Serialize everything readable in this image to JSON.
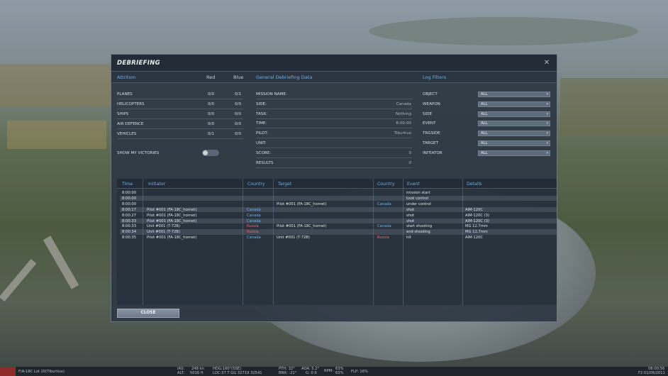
{
  "dialog": {
    "title": "DEBRIEFING",
    "close_icon": "close-icon"
  },
  "sections": {
    "attrition": "Attrition",
    "red": "Red",
    "blue": "Blue",
    "general": "General Debriefing Data",
    "filters": "Log Filters"
  },
  "attrition": [
    {
      "label": "PLANES",
      "red": "0/0",
      "blue": "0/1"
    },
    {
      "label": "HELICOPTERS",
      "red": "0/0",
      "blue": "0/0"
    },
    {
      "label": "SHIPS",
      "red": "0/0",
      "blue": "0/0"
    },
    {
      "label": "AIR DEFENCE",
      "red": "0/0",
      "blue": "0/0"
    },
    {
      "label": "VEHICLES",
      "red": "0/1",
      "blue": "0/0"
    }
  ],
  "show_victories": "SHOW MY VICTORIES",
  "general": [
    {
      "label": "MISSION NAME:",
      "value": ""
    },
    {
      "label": "SIDE:",
      "value": "Canada"
    },
    {
      "label": "TASK:",
      "value": "Nothing"
    },
    {
      "label": "TIME:",
      "value": "8:00:00"
    },
    {
      "label": "PILOT:",
      "value": "Tiburtius"
    },
    {
      "label": "UNIT:",
      "value": ""
    },
    {
      "label": "SCORE:",
      "value": "0"
    },
    {
      "label": "RESULTS",
      "value": "0"
    }
  ],
  "filters": [
    {
      "label": "OBJECT",
      "value": "ALL"
    },
    {
      "label": "WEAPON",
      "value": "ALL"
    },
    {
      "label": "SIDE",
      "value": "ALL"
    },
    {
      "label": "EVENT",
      "value": "ALL"
    },
    {
      "label": "TRGSIDE",
      "value": "ALL"
    },
    {
      "label": "TARGET",
      "value": "ALL"
    },
    {
      "label": "INITIATOR",
      "value": "ALL"
    }
  ],
  "log": {
    "columns": {
      "time": "Time",
      "initiator": "Initiator",
      "country": "Country",
      "target": "Target",
      "tcountry": "Country",
      "event": "Event",
      "details": "Details"
    },
    "rows": [
      {
        "time": "8:00:00",
        "initiator": "",
        "country": "",
        "target": "",
        "tcountry": "",
        "event": "mission start",
        "details": ""
      },
      {
        "time": "8:00:00",
        "initiator": "",
        "country": "",
        "target": "",
        "tcountry": "",
        "event": "took control",
        "details": ""
      },
      {
        "time": "8:00:00",
        "initiator": "",
        "country": "",
        "target": "Pilot #001 (FA-18C_hornet)",
        "tcountry": "Canada",
        "event": "under control",
        "details": ""
      },
      {
        "time": "8:00:17",
        "initiator": "Pilot #001 (FA-18C_hornet)",
        "country": "Canada",
        "target": "",
        "tcountry": "",
        "event": "shot",
        "details": "AIM-120C"
      },
      {
        "time": "8:00:27",
        "initiator": "Pilot #001 (FA-18C_hornet)",
        "country": "Canada",
        "target": "",
        "tcountry": "",
        "event": "shot",
        "details": "AIM-120C (3)"
      },
      {
        "time": "8:00:33",
        "initiator": "Pilot #001 (FA-18C_hornet)",
        "country": "Canada",
        "target": "",
        "tcountry": "",
        "event": "shot",
        "details": "AIM-120C (3)"
      },
      {
        "time": "8:00:33",
        "initiator": "Unit #001 (T-72B)",
        "country": "Russia",
        "target": "Pilot #001 (FA-18C_hornet)",
        "tcountry": "Canada",
        "event": "start shooting",
        "details": "MG 12.7mm"
      },
      {
        "time": "8:00:34",
        "initiator": "Unit #001 (T-72B)",
        "country": "Russia",
        "target": "",
        "tcountry": "",
        "event": "end shooting",
        "details": "MG 12.7mm"
      },
      {
        "time": "8:00:35",
        "initiator": "Pilot #001 (FA-18C_hornet)",
        "country": "Canada",
        "target": "Unit #001 (T-72B)",
        "tcountry": "Russia",
        "event": "hit",
        "details": "AIM-120C"
      }
    ]
  },
  "close_label": "CLOSE",
  "hud": {
    "aircraft": "F/A-18C Lot 20(Tiburtius)",
    "ias_label": "IAS:",
    "ias": "248 kn",
    "alt_label": "ALT:",
    "alt": "5016 ft",
    "hdg": "HDG:160°(SSE)",
    "loc": "LOC:37 T GG 32719 32541",
    "pth": "PTH: 32°",
    "bnk": "BNK: -21°",
    "aoa": "AOA: 5.2°",
    "g": "G: 0.9",
    "rpm_label": "RPM:",
    "rpm1": "63%",
    "rpm2": "63%",
    "flp": "FLP: 16%",
    "time": "08:00:56",
    "date": "F2 01/06/2011"
  }
}
